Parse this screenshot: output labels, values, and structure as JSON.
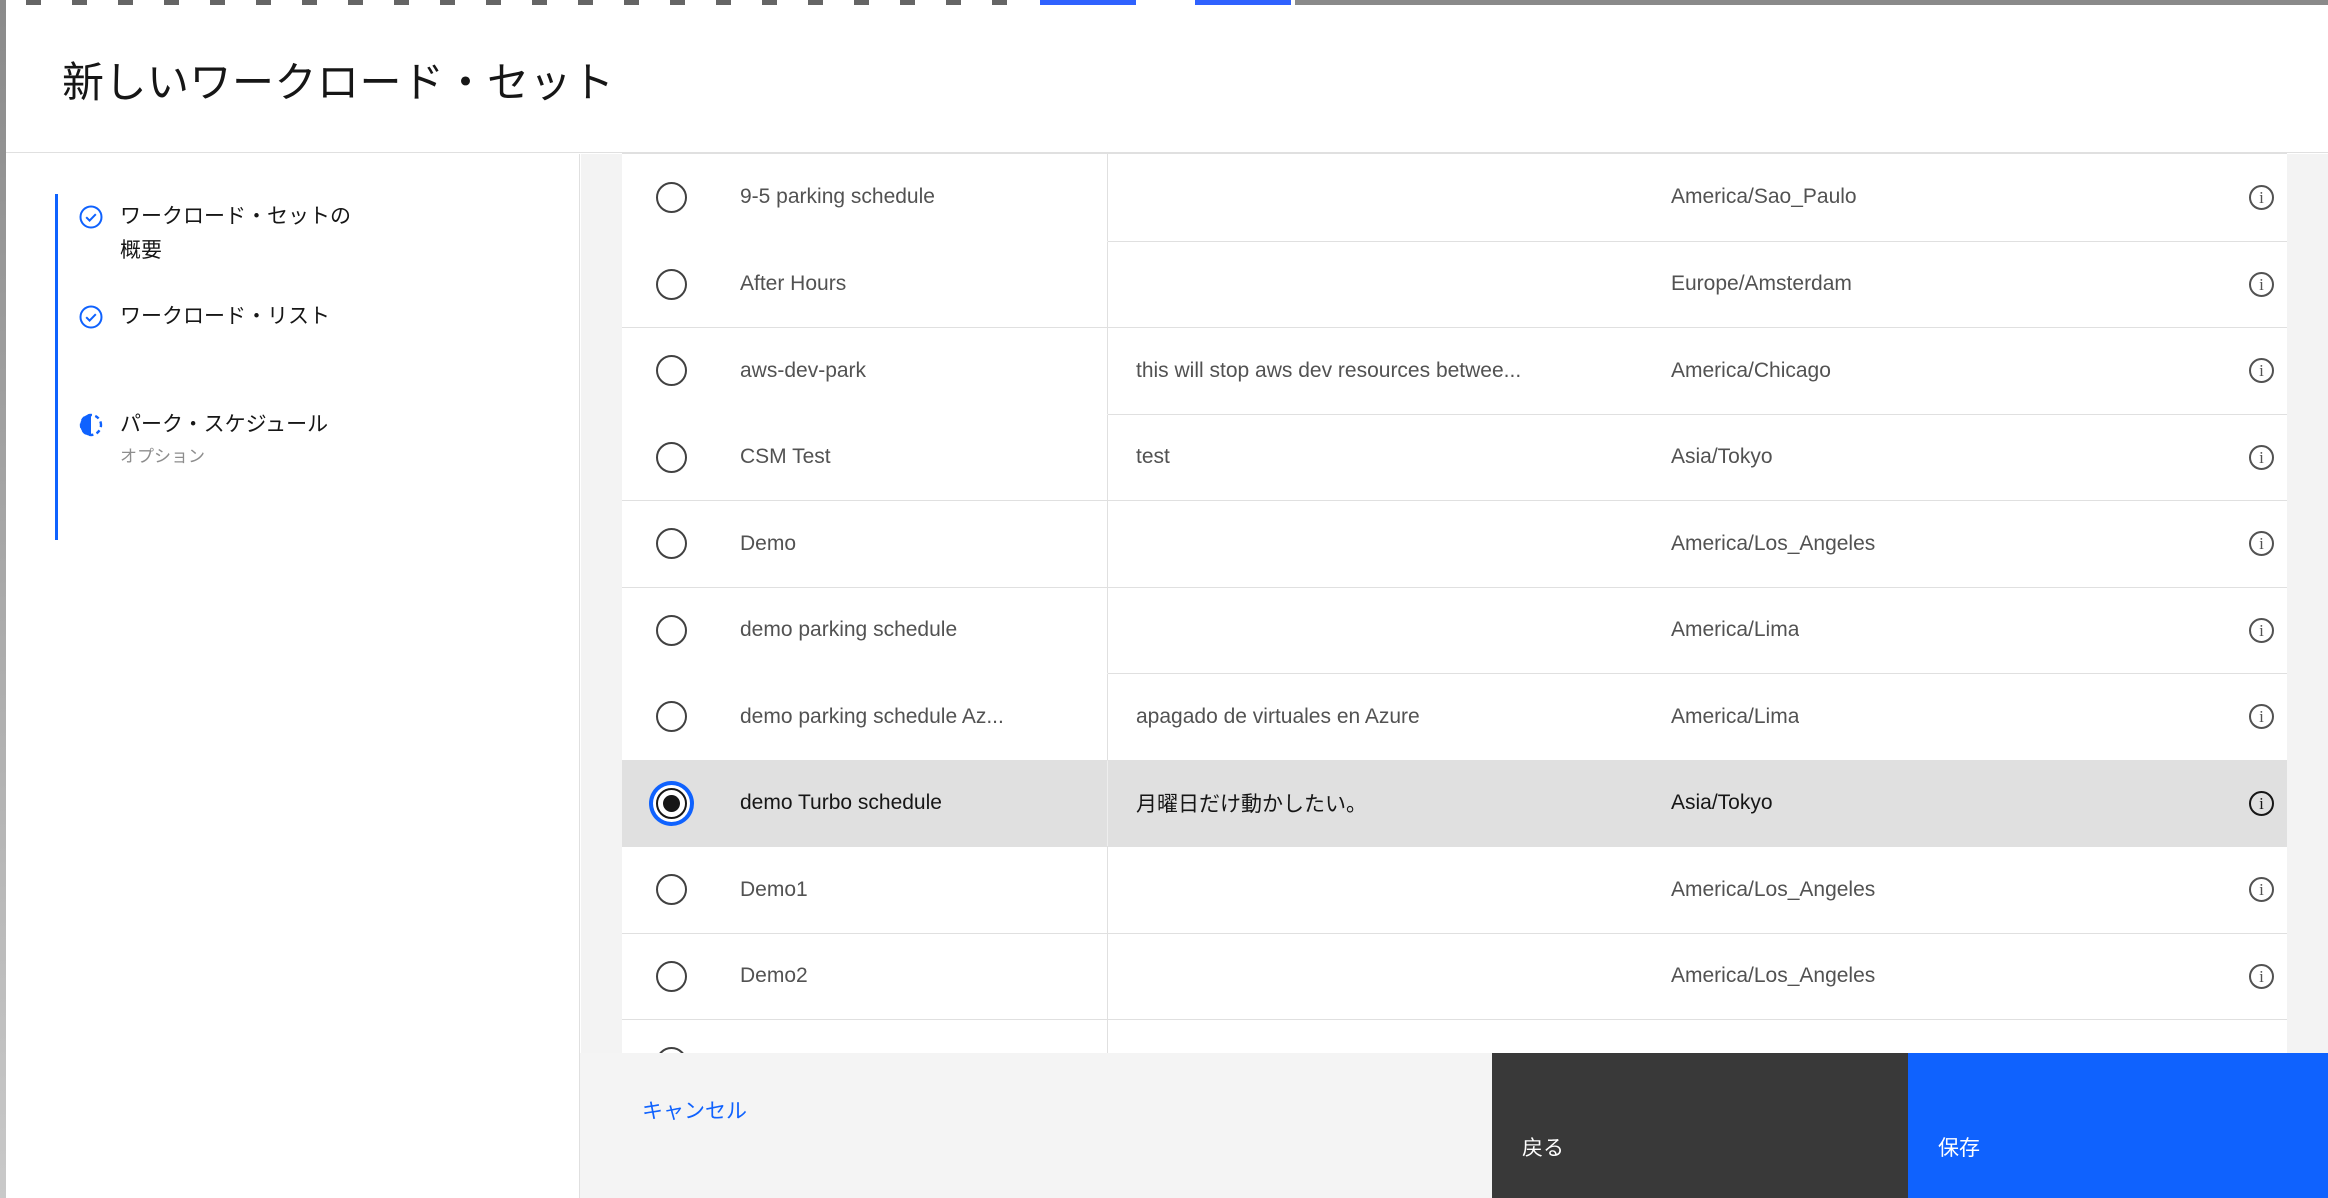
{
  "modal": {
    "title": "新しいワークロード・セット"
  },
  "stepper": {
    "steps": [
      {
        "lines": [
          "ワークロード・セットの",
          "概要"
        ],
        "state": "complete",
        "icon": "checkmark-circle-icon"
      },
      {
        "lines": [
          "ワークロード・リスト"
        ],
        "state": "complete",
        "icon": "checkmark-circle-icon"
      },
      {
        "lines": [
          "パーク・スケジュール"
        ],
        "sublabel": "オプション",
        "state": "current",
        "icon": "incomplete-step-icon"
      }
    ]
  },
  "table": {
    "rows": [
      {
        "name": "9-5 parking schedule",
        "description": "",
        "timezone": "America/Sao_Paulo",
        "selected": false
      },
      {
        "name": "After Hours",
        "description": "",
        "timezone": "Europe/Amsterdam",
        "selected": false,
        "col1_top_border": false
      },
      {
        "name": "aws-dev-park",
        "description": "this will stop aws dev resources betwee...",
        "timezone": "America/Chicago",
        "selected": false
      },
      {
        "name": "CSM Test",
        "description": "test",
        "timezone": "Asia/Tokyo",
        "selected": false,
        "col1_top_border": false
      },
      {
        "name": "Demo",
        "description": "",
        "timezone": "America/Los_Angeles",
        "selected": false
      },
      {
        "name": "demo parking schedule",
        "description": "",
        "timezone": "America/Lima",
        "selected": false
      },
      {
        "name": "demo parking schedule Az...",
        "description": "apagado de virtuales en Azure",
        "timezone": "America/Lima",
        "selected": false,
        "col1_top_border": false
      },
      {
        "name": "demo Turbo schedule",
        "description": "月曜日だけ動かしたい。",
        "timezone": "Asia/Tokyo",
        "selected": true
      },
      {
        "name": "Demo1",
        "description": "",
        "timezone": "America/Los_Angeles",
        "selected": false
      },
      {
        "name": "Demo2",
        "description": "",
        "timezone": "America/Los_Angeles",
        "selected": false
      },
      {
        "name": "",
        "description": "",
        "timezone": "",
        "selected": false,
        "clipped": true
      }
    ],
    "info_icon_glyph": "i"
  },
  "footer": {
    "cancel_label": "キャンセル",
    "back_label": "戻る",
    "save_label": "保存"
  },
  "colors": {
    "accent_blue": "#0f62fe",
    "selected_row_bg": "#e0e0e0",
    "secondary_button_bg": "#393939",
    "row_border": "#e0e0e0",
    "body_text": "#525252"
  }
}
